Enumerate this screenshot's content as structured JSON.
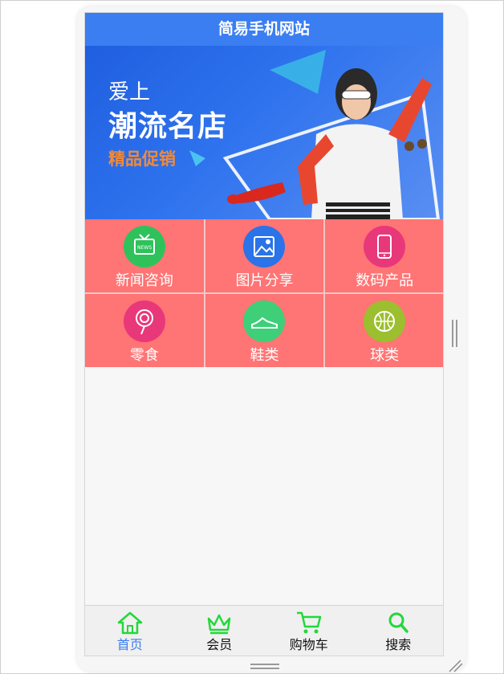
{
  "header": {
    "title": "简易手机网站"
  },
  "banner": {
    "line1": "爱上",
    "line2": "潮流名店",
    "line3": "精品促销"
  },
  "categories": [
    {
      "label": "新闻咨询",
      "icon": "news-tv-icon",
      "color": "#2fc25b"
    },
    {
      "label": "图片分享",
      "icon": "image-icon",
      "color": "#2a73e8"
    },
    {
      "label": "数码产品",
      "icon": "phone-icon",
      "color": "#e8387a"
    },
    {
      "label": "零食",
      "icon": "lollipop-icon",
      "color": "#e8387a"
    },
    {
      "label": "鞋类",
      "icon": "shoe-icon",
      "color": "#3ecf78"
    },
    {
      "label": "球类",
      "icon": "ball-icon",
      "color": "#9bbf2e"
    }
  ],
  "tabs": [
    {
      "label": "首页",
      "icon": "home-icon",
      "active": true
    },
    {
      "label": "会员",
      "icon": "crown-icon",
      "active": false
    },
    {
      "label": "购物车",
      "icon": "cart-icon",
      "active": false
    },
    {
      "label": "搜索",
      "icon": "search-icon",
      "active": false
    }
  ],
  "colors": {
    "header": "#3a7ef2",
    "grid_cell": "#ff7474",
    "tab_icon": "#22d83a",
    "tab_active_text": "#3a7ef2"
  }
}
